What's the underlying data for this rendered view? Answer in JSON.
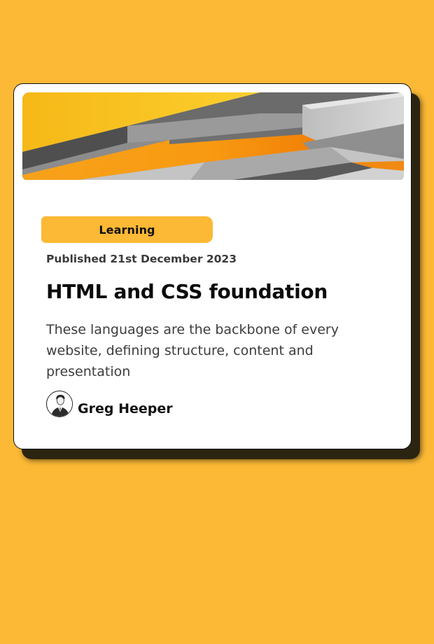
{
  "card": {
    "tag": "Learning",
    "published": "Published 21st December 2023",
    "title": "HTML and CSS foundation",
    "description": "These languages are the backbone of every website, defining structure, content and presentation",
    "author": {
      "name": "Greg Heeper",
      "avatar_icon": "person-avatar-icon"
    },
    "hero_image": "abstract-grey-orange-layers-image"
  },
  "colors": {
    "background": "#FCB935",
    "card": "#FFFFFF",
    "badge": "#FCB935",
    "shadow": "#2B2410",
    "title": "#0B0B0B",
    "text": "#3D3D3D"
  }
}
